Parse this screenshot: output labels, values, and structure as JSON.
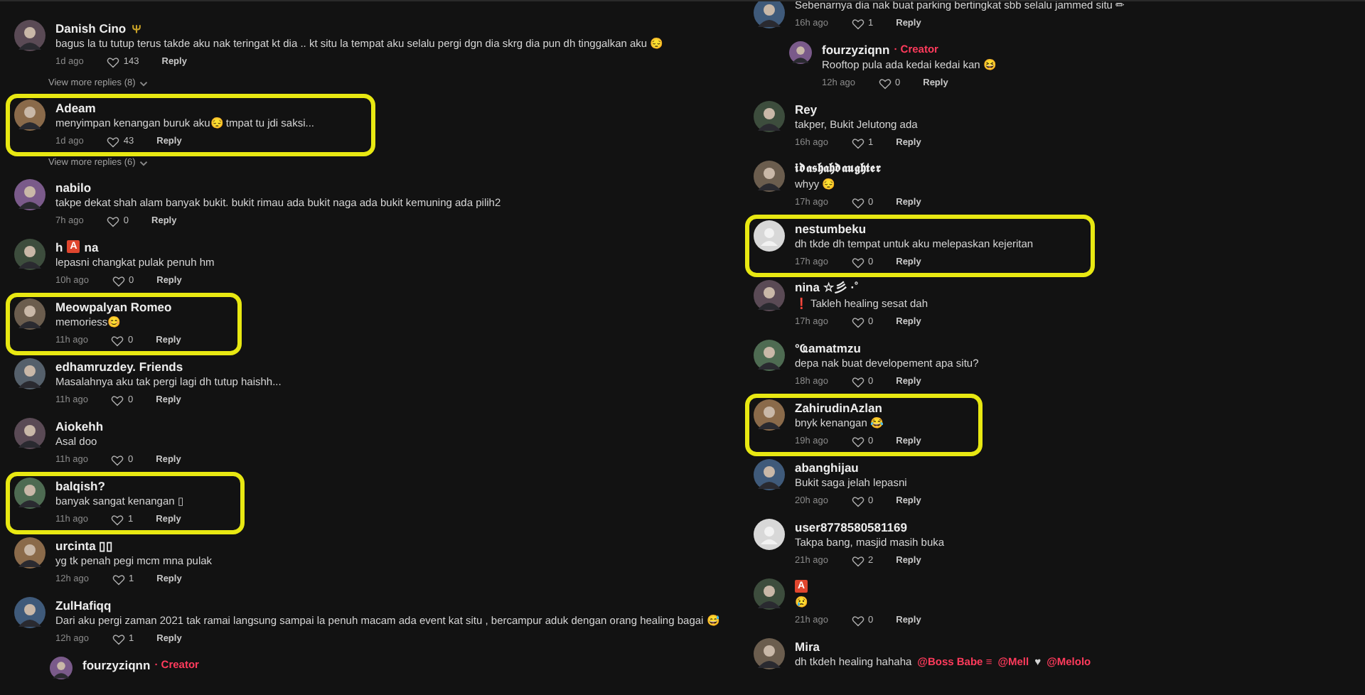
{
  "left": {
    "items": [
      {
        "kind": "comment",
        "name": "Danish Cino",
        "emblem": true,
        "text": "bagus la tu tutup terus takde aku nak teringat kt dia .. kt situ la tempat aku selalu pergi dgn dia skrg dia pun dh tinggalkan aku 😔",
        "time": "1d ago",
        "likes": "143",
        "reply": "Reply",
        "highlighted": false
      },
      {
        "kind": "more",
        "text": "View more replies (8)"
      },
      {
        "kind": "comment",
        "name": "Adeam",
        "text": "menyimpan kenangan buruk aku😔 tmpat tu jdi saksi...",
        "time": "1d ago",
        "likes": "43",
        "reply": "Reply",
        "highlighted": true
      },
      {
        "kind": "more",
        "text": "View more replies (6)"
      },
      {
        "kind": "comment",
        "name": "nabilo",
        "text": "takpe dekat shah alam banyak bukit. bukit rimau ada bukit naga ada bukit kemuning ada pilih2",
        "time": "7h ago",
        "likes": "0",
        "reply": "Reply",
        "highlighted": false
      },
      {
        "kind": "comment",
        "name": "h",
        "badge": "A",
        "name_after": "na",
        "text": "lepasni changkat pulak penuh hm",
        "time": "10h ago",
        "likes": "0",
        "reply": "Reply",
        "highlighted": false
      },
      {
        "kind": "comment",
        "name": "Meowpalyan Romeo",
        "text": "memoriess😊",
        "time": "11h ago",
        "likes": "0",
        "reply": "Reply",
        "highlighted": true
      },
      {
        "kind": "comment",
        "name": "edhamruzdey. Friends",
        "text": "Masalahnya aku tak pergi lagi dh tutup haishh...",
        "time": "11h ago",
        "likes": "0",
        "reply": "Reply",
        "highlighted": false
      },
      {
        "kind": "comment",
        "name": "Aiokehh",
        "text": "Asal doo",
        "time": "11h ago",
        "likes": "0",
        "reply": "Reply",
        "highlighted": false
      },
      {
        "kind": "comment",
        "name": "balqish?",
        "text": "banyak sangat kenangan ▯",
        "time": "11h ago",
        "likes": "1",
        "reply": "Reply",
        "highlighted": true
      },
      {
        "kind": "comment",
        "name": "urcinta ▯▯",
        "text": "yg tk penah pegi mcm mna pulak",
        "time": "12h ago",
        "likes": "1",
        "reply": "Reply",
        "highlighted": false
      },
      {
        "kind": "comment",
        "name": "ZulHafiqq",
        "text": "Dari aku pergi zaman 2021 tak ramai langsung sampai la penuh macam ada event kat situ , bercampur aduk dengan orang healing bagai 😅",
        "time": "12h ago",
        "likes": "1",
        "reply": "Reply",
        "highlighted": false
      },
      {
        "kind": "reply",
        "name": "fourzyziqnn",
        "tag": "· Creator",
        "highlighted": false
      }
    ]
  },
  "right": {
    "items": [
      {
        "kind": "comment",
        "text": "Sebenarnya dia nak buat parking bertingkat sbb selalu jammed situ ✏",
        "time": "16h ago",
        "likes": "1",
        "reply": "Reply",
        "highlighted": false
      },
      {
        "kind": "reply",
        "name": "fourzyziqnn",
        "tag": "· Creator",
        "text": "Rooftop pula ada kedai kedai kan 😆",
        "time": "12h ago",
        "likes": "0",
        "reply": "Reply",
        "highlighted": false
      },
      {
        "kind": "comment",
        "name": "Rey",
        "text": "takper, Bukit Jelutong ada",
        "time": "16h ago",
        "likes": "1",
        "reply": "Reply",
        "highlighted": false
      },
      {
        "kind": "comment",
        "name": "𝖎𝖉𝖆𝖘𝖍𝖆𝖍𝖉𝖆𝖚𝖌𝖍𝖙𝖊𝖗",
        "text": "whyy 😔",
        "time": "17h ago",
        "likes": "0",
        "reply": "Reply",
        "highlighted": false
      },
      {
        "kind": "comment",
        "name": "nestumbeku",
        "avatar": {
          "kind": "default"
        },
        "text": "dh tkde dh tempat untuk aku melepaskan kejeritan",
        "time": "17h ago",
        "likes": "0",
        "reply": "Reply",
        "highlighted": true
      },
      {
        "kind": "comment",
        "name": "nina ☆彡 ·˚",
        "text": "❗ Takleh healing sesat dah",
        "time": "17h ago",
        "likes": "0",
        "reply": "Reply",
        "highlighted": false
      },
      {
        "kind": "comment",
        "name": "°Ҩamatmzu",
        "text": "depa nak buat developement apa situ?",
        "time": "18h ago",
        "likes": "0",
        "reply": "Reply",
        "highlighted": false
      },
      {
        "kind": "comment",
        "name": "ZahirudinAzlan",
        "text": "bnyk kenangan 😂",
        "time": "19h ago",
        "likes": "0",
        "reply": "Reply",
        "highlighted": true
      },
      {
        "kind": "comment",
        "name": "abanghijau",
        "text": "Bukit saga jelah lepasni",
        "time": "20h ago",
        "likes": "0",
        "reply": "Reply",
        "highlighted": false
      },
      {
        "kind": "comment",
        "name": "user8778580581169",
        "avatar": {
          "kind": "default"
        },
        "text": "Takpa bang, masjid masih buka",
        "time": "21h ago",
        "likes": "2",
        "reply": "Reply",
        "highlighted": false
      },
      {
        "kind": "comment",
        "badge": "A",
        "text": "😢",
        "time": "21h ago",
        "likes": "0",
        "reply": "Reply",
        "highlighted": false
      },
      {
        "kind": "comment",
        "name": "Mira",
        "parts": [
          {
            "kind": "plain",
            "text": "dh tkdeh healing hahaha"
          },
          {
            "kind": "mention",
            "text": "@Boss Babe ≡"
          },
          {
            "kind": "mention",
            "text": "@Mell"
          },
          {
            "kind": "plain",
            "text": "♥"
          },
          {
            "kind": "mention",
            "text": "@Melolo"
          }
        ],
        "highlighted": false
      }
    ]
  }
}
